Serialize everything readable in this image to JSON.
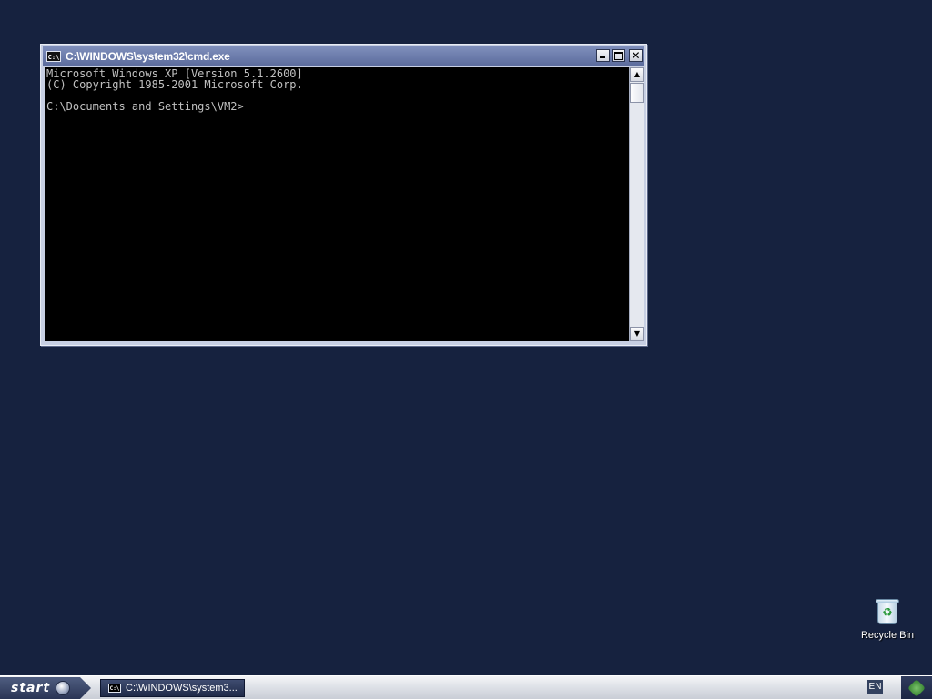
{
  "cmd_window": {
    "title": "C:\\WINDOWS\\system32\\cmd.exe",
    "icon_text": "C:\\",
    "console_lines": [
      "Microsoft Windows XP [Version 5.1.2600]",
      "(C) Copyright 1985-2001 Microsoft Corp.",
      "",
      "C:\\Documents and Settings\\VM2>"
    ],
    "buttons": {
      "minimize_icon": "minimize-icon",
      "maximize_icon": "maximize-icon",
      "close_label": "✕"
    },
    "scrollbar": {
      "up_arrow": "▲",
      "down_arrow": "▼"
    }
  },
  "desktop": {
    "icons": [
      {
        "label": "Recycle Bin",
        "icon": "recycle-bin-icon",
        "glyph": "♻"
      }
    ]
  },
  "taskbar": {
    "start_label": "start",
    "tasks": [
      {
        "label": "C:\\WINDOWS\\system3...",
        "icon_text": "C:\\"
      }
    ],
    "language": "EN",
    "tray_icon": "network-tray-icon"
  },
  "colors": {
    "desktop_background": "#16223f",
    "console_background": "#000000",
    "console_text": "#c0c0c0"
  }
}
